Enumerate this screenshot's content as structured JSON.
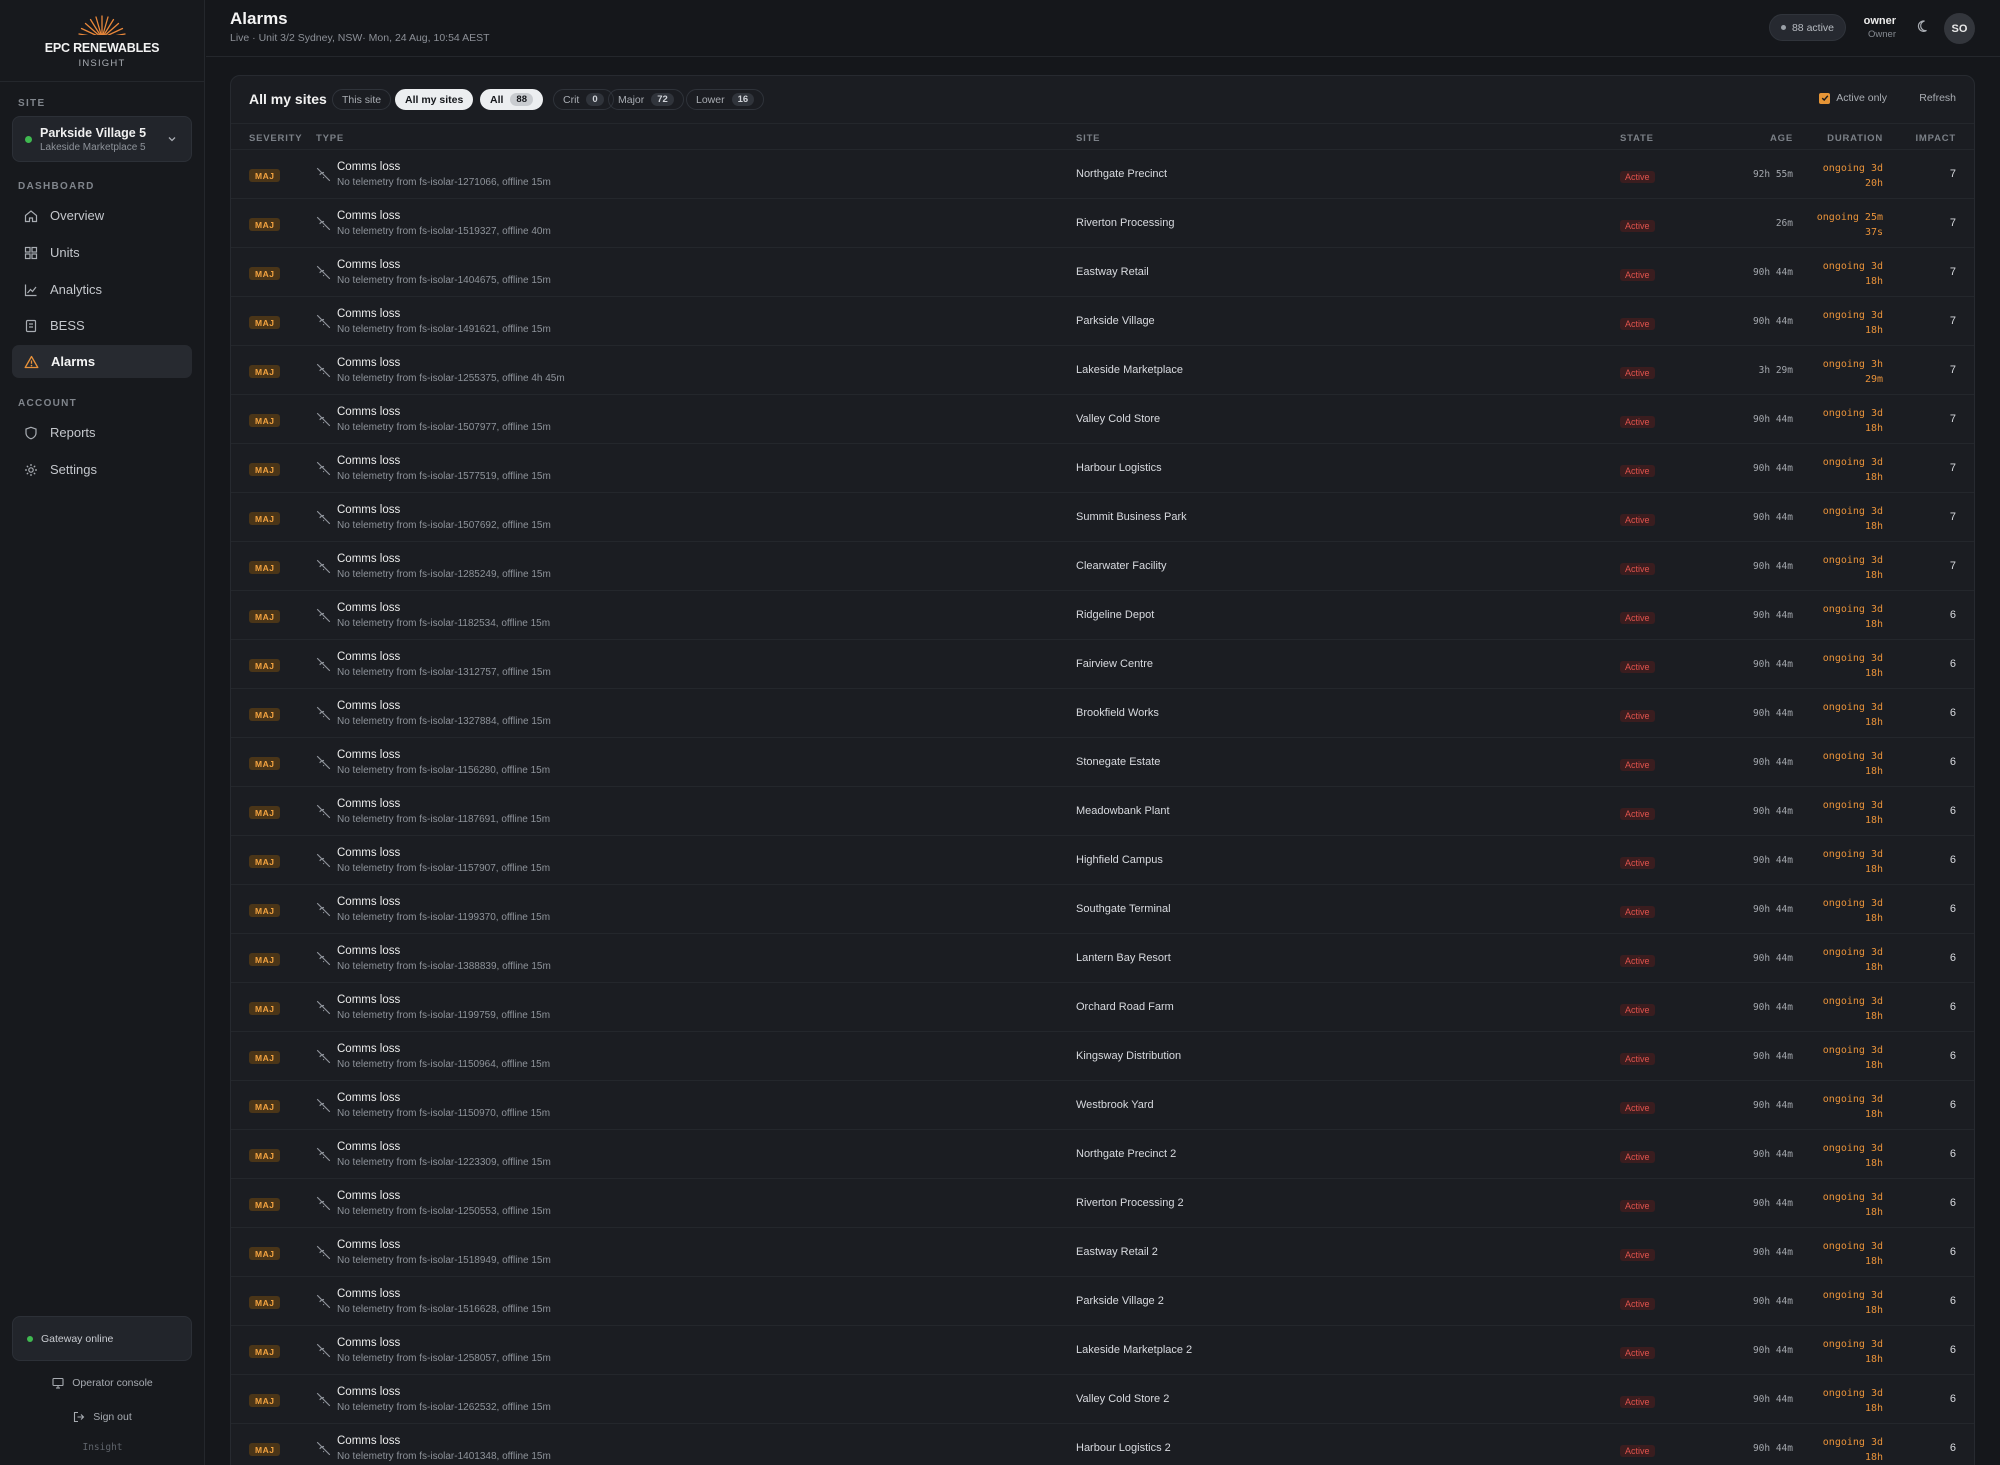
{
  "brand": {
    "name": "EPC RENEWABLES",
    "sub": "INSIGHT"
  },
  "sidebar": {
    "site_section": "SITE",
    "site": {
      "name": "Parkside Village 5",
      "sub": "Lakeside Marketplace 5",
      "status_color": "#3fb950"
    },
    "dashboard_section": "DASHBOARD",
    "dashboard_items": [
      {
        "label": "Overview",
        "icon": "home-icon"
      },
      {
        "label": "Units",
        "icon": "grid-icon"
      },
      {
        "label": "Analytics",
        "icon": "chart-icon"
      },
      {
        "label": "BESS",
        "icon": "battery-icon"
      },
      {
        "label": "Alarms",
        "icon": "warning-icon",
        "active": true
      }
    ],
    "account_section": "ACCOUNT",
    "account_items": [
      {
        "label": "Reports",
        "icon": "shield-icon"
      },
      {
        "label": "Settings",
        "icon": "gear-icon"
      }
    ],
    "gateway": "Gateway online",
    "operator_console": "Operator console",
    "sign_out": "Sign out",
    "footer": "Insight"
  },
  "header": {
    "title": "Alarms",
    "subtitle": "Live · Unit 3/2 Sydney, NSW· Mon, 24 Aug, 10:54 AEST",
    "active_count": "88 active",
    "user_name": "owner",
    "user_role": "Owner",
    "avatar": "SO"
  },
  "toolbar": {
    "title": "All my sites",
    "scope": {
      "this_site": "This site",
      "all_sites": "All my sites"
    },
    "filters": [
      {
        "label": "All",
        "count": "88",
        "selected": true
      },
      {
        "label": "Crit",
        "count": "0"
      },
      {
        "label": "Major",
        "count": "72"
      },
      {
        "label": "Lower",
        "count": "16"
      }
    ],
    "active_only": "Active only",
    "refresh": "Refresh"
  },
  "columns": {
    "severity": "SEVERITY",
    "type": "TYPE",
    "site": "SITE",
    "state": "STATE",
    "age": "AGE",
    "duration": "DURATION",
    "impact": "IMPACT"
  },
  "colors": {
    "accent_orange": "#e8923a",
    "danger_red": "#e0534d",
    "ok_green": "#3fb950"
  },
  "alarms": [
    {
      "sev": "MAJ",
      "type": "Comms loss",
      "desc": "No telemetry from fs-isolar-1271066, offline 15m",
      "site": "Northgate Precinct",
      "state": "Active",
      "age": "92h 55m",
      "dur1": "ongoing 3d",
      "dur2": "20h",
      "impact": "7"
    },
    {
      "sev": "MAJ",
      "type": "Comms loss",
      "desc": "No telemetry from fs-isolar-1519327, offline 40m",
      "site": "Riverton Processing",
      "state": "Active",
      "age": "26m",
      "dur1": "ongoing 25m",
      "dur2": "37s",
      "impact": "7"
    },
    {
      "sev": "MAJ",
      "type": "Comms loss",
      "desc": "No telemetry from fs-isolar-1404675, offline 15m",
      "site": "Eastway Retail",
      "state": "Active",
      "age": "90h 44m",
      "dur1": "ongoing 3d",
      "dur2": "18h",
      "impact": "7"
    },
    {
      "sev": "MAJ",
      "type": "Comms loss",
      "desc": "No telemetry from fs-isolar-1491621, offline 15m",
      "site": "Parkside Village",
      "state": "Active",
      "age": "90h 44m",
      "dur1": "ongoing 3d",
      "dur2": "18h",
      "impact": "7"
    },
    {
      "sev": "MAJ",
      "type": "Comms loss",
      "desc": "No telemetry from fs-isolar-1255375, offline 4h 45m",
      "site": "Lakeside Marketplace",
      "state": "Active",
      "age": "3h 29m",
      "dur1": "ongoing 3h",
      "dur2": "29m",
      "impact": "7"
    },
    {
      "sev": "MAJ",
      "type": "Comms loss",
      "desc": "No telemetry from fs-isolar-1507977, offline 15m",
      "site": "Valley Cold Store",
      "state": "Active",
      "age": "90h 44m",
      "dur1": "ongoing 3d",
      "dur2": "18h",
      "impact": "7"
    },
    {
      "sev": "MAJ",
      "type": "Comms loss",
      "desc": "No telemetry from fs-isolar-1577519, offline 15m",
      "site": "Harbour Logistics",
      "state": "Active",
      "age": "90h 44m",
      "dur1": "ongoing 3d",
      "dur2": "18h",
      "impact": "7"
    },
    {
      "sev": "MAJ",
      "type": "Comms loss",
      "desc": "No telemetry from fs-isolar-1507692, offline 15m",
      "site": "Summit Business Park",
      "state": "Active",
      "age": "90h 44m",
      "dur1": "ongoing 3d",
      "dur2": "18h",
      "impact": "7"
    },
    {
      "sev": "MAJ",
      "type": "Comms loss",
      "desc": "No telemetry from fs-isolar-1285249, offline 15m",
      "site": "Clearwater Facility",
      "state": "Active",
      "age": "90h 44m",
      "dur1": "ongoing 3d",
      "dur2": "18h",
      "impact": "7"
    },
    {
      "sev": "MAJ",
      "type": "Comms loss",
      "desc": "No telemetry from fs-isolar-1182534, offline 15m",
      "site": "Ridgeline Depot",
      "state": "Active",
      "age": "90h 44m",
      "dur1": "ongoing 3d",
      "dur2": "18h",
      "impact": "6"
    },
    {
      "sev": "MAJ",
      "type": "Comms loss",
      "desc": "No telemetry from fs-isolar-1312757, offline 15m",
      "site": "Fairview Centre",
      "state": "Active",
      "age": "90h 44m",
      "dur1": "ongoing 3d",
      "dur2": "18h",
      "impact": "6"
    },
    {
      "sev": "MAJ",
      "type": "Comms loss",
      "desc": "No telemetry from fs-isolar-1327884, offline 15m",
      "site": "Brookfield Works",
      "state": "Active",
      "age": "90h 44m",
      "dur1": "ongoing 3d",
      "dur2": "18h",
      "impact": "6"
    },
    {
      "sev": "MAJ",
      "type": "Comms loss",
      "desc": "No telemetry from fs-isolar-1156280, offline 15m",
      "site": "Stonegate Estate",
      "state": "Active",
      "age": "90h 44m",
      "dur1": "ongoing 3d",
      "dur2": "18h",
      "impact": "6"
    },
    {
      "sev": "MAJ",
      "type": "Comms loss",
      "desc": "No telemetry from fs-isolar-1187691, offline 15m",
      "site": "Meadowbank Plant",
      "state": "Active",
      "age": "90h 44m",
      "dur1": "ongoing 3d",
      "dur2": "18h",
      "impact": "6"
    },
    {
      "sev": "MAJ",
      "type": "Comms loss",
      "desc": "No telemetry from fs-isolar-1157907, offline 15m",
      "site": "Highfield Campus",
      "state": "Active",
      "age": "90h 44m",
      "dur1": "ongoing 3d",
      "dur2": "18h",
      "impact": "6"
    },
    {
      "sev": "MAJ",
      "type": "Comms loss",
      "desc": "No telemetry from fs-isolar-1199370, offline 15m",
      "site": "Southgate Terminal",
      "state": "Active",
      "age": "90h 44m",
      "dur1": "ongoing 3d",
      "dur2": "18h",
      "impact": "6"
    },
    {
      "sev": "MAJ",
      "type": "Comms loss",
      "desc": "No telemetry from fs-isolar-1388839, offline 15m",
      "site": "Lantern Bay Resort",
      "state": "Active",
      "age": "90h 44m",
      "dur1": "ongoing 3d",
      "dur2": "18h",
      "impact": "6"
    },
    {
      "sev": "MAJ",
      "type": "Comms loss",
      "desc": "No telemetry from fs-isolar-1199759, offline 15m",
      "site": "Orchard Road Farm",
      "state": "Active",
      "age": "90h 44m",
      "dur1": "ongoing 3d",
      "dur2": "18h",
      "impact": "6"
    },
    {
      "sev": "MAJ",
      "type": "Comms loss",
      "desc": "No telemetry from fs-isolar-1150964, offline 15m",
      "site": "Kingsway Distribution",
      "state": "Active",
      "age": "90h 44m",
      "dur1": "ongoing 3d",
      "dur2": "18h",
      "impact": "6"
    },
    {
      "sev": "MAJ",
      "type": "Comms loss",
      "desc": "No telemetry from fs-isolar-1150970, offline 15m",
      "site": "Westbrook Yard",
      "state": "Active",
      "age": "90h 44m",
      "dur1": "ongoing 3d",
      "dur2": "18h",
      "impact": "6"
    },
    {
      "sev": "MAJ",
      "type": "Comms loss",
      "desc": "No telemetry from fs-isolar-1223309, offline 15m",
      "site": "Northgate Precinct 2",
      "state": "Active",
      "age": "90h 44m",
      "dur1": "ongoing 3d",
      "dur2": "18h",
      "impact": "6"
    },
    {
      "sev": "MAJ",
      "type": "Comms loss",
      "desc": "No telemetry from fs-isolar-1250553, offline 15m",
      "site": "Riverton Processing 2",
      "state": "Active",
      "age": "90h 44m",
      "dur1": "ongoing 3d",
      "dur2": "18h",
      "impact": "6"
    },
    {
      "sev": "MAJ",
      "type": "Comms loss",
      "desc": "No telemetry from fs-isolar-1518949, offline 15m",
      "site": "Eastway Retail 2",
      "state": "Active",
      "age": "90h 44m",
      "dur1": "ongoing 3d",
      "dur2": "18h",
      "impact": "6"
    },
    {
      "sev": "MAJ",
      "type": "Comms loss",
      "desc": "No telemetry from fs-isolar-1516628, offline 15m",
      "site": "Parkside Village 2",
      "state": "Active",
      "age": "90h 44m",
      "dur1": "ongoing 3d",
      "dur2": "18h",
      "impact": "6"
    },
    {
      "sev": "MAJ",
      "type": "Comms loss",
      "desc": "No telemetry from fs-isolar-1258057, offline 15m",
      "site": "Lakeside Marketplace 2",
      "state": "Active",
      "age": "90h 44m",
      "dur1": "ongoing 3d",
      "dur2": "18h",
      "impact": "6"
    },
    {
      "sev": "MAJ",
      "type": "Comms loss",
      "desc": "No telemetry from fs-isolar-1262532, offline 15m",
      "site": "Valley Cold Store 2",
      "state": "Active",
      "age": "90h 44m",
      "dur1": "ongoing 3d",
      "dur2": "18h",
      "impact": "6"
    },
    {
      "sev": "MAJ",
      "type": "Comms loss",
      "desc": "No telemetry from fs-isolar-1401348, offline 15m",
      "site": "Harbour Logistics 2",
      "state": "Active",
      "age": "90h 44m",
      "dur1": "ongoing 3d",
      "dur2": "18h",
      "impact": "6"
    }
  ]
}
